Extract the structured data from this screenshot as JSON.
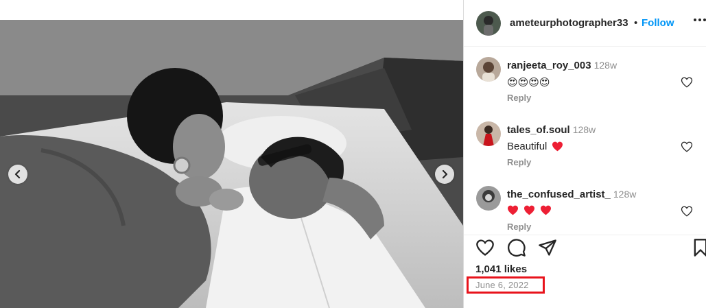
{
  "post": {
    "username": "ameteurphotographer33",
    "separator": "•",
    "follow_label": "Follow",
    "likes": "1,041 likes",
    "date": "June 6, 2022"
  },
  "comments": [
    {
      "username": "ranjeeta_roy_003",
      "time": "128w",
      "text": "😍😍😍😍",
      "reply_label": "Reply"
    },
    {
      "username": "tales_of.soul",
      "time": "128w",
      "text": "Beautiful",
      "reply_label": "Reply"
    },
    {
      "username": "the_confused_artist_",
      "time": "128w",
      "text": "",
      "reply_label": "Reply"
    }
  ],
  "icons": {
    "prev": "chevron-left-icon",
    "next": "chevron-right-icon",
    "more": "more-horizontal-icon",
    "like": "heart-icon",
    "comment": "comment-icon",
    "share": "send-icon",
    "save": "bookmark-icon"
  },
  "colors": {
    "follow": "#0095f6",
    "highlight_box": "#e8131b",
    "heart_emoji": "#ed1f34"
  }
}
